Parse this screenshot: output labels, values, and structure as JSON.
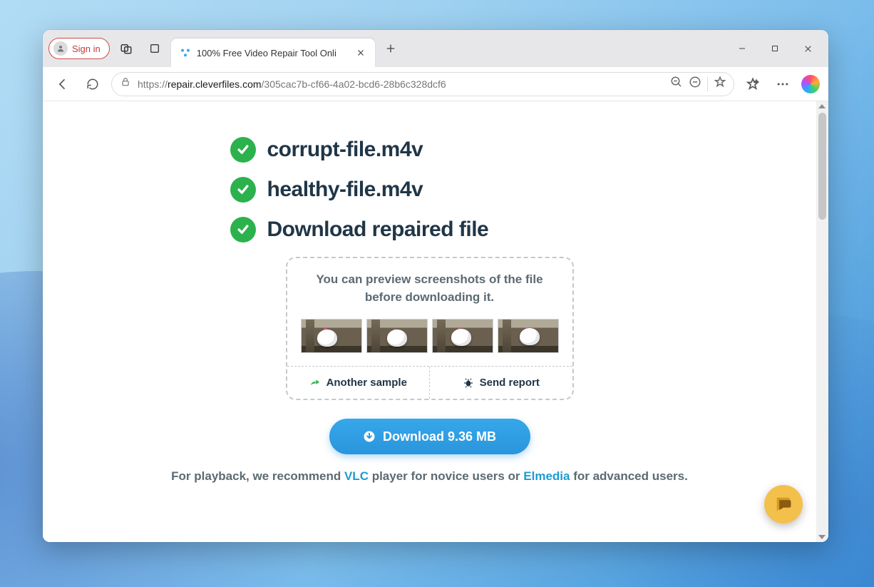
{
  "browser": {
    "sign_in": "Sign in",
    "tab_title": "100% Free Video Repair Tool Onli",
    "url_host": "repair.cleverfiles.com",
    "url_path": "/305cac7b-cf66-4a02-bcd6-28b6c328dcf6",
    "url_scheme": "https://"
  },
  "steps": {
    "s1": "corrupt-file.m4v",
    "s2": "healthy-file.m4v",
    "s3": "Download repaired file"
  },
  "preview": {
    "text": "You can preview screenshots of the file before downloading it.",
    "another_sample": "Another sample",
    "send_report": "Send report"
  },
  "download": {
    "label": "Download 9.36 MB"
  },
  "recommend": {
    "pre": "For playback, we recommend ",
    "vlc": "VLC",
    "mid": " player for novice users or ",
    "elmedia": "Elmedia",
    "post": " for advanced users."
  }
}
